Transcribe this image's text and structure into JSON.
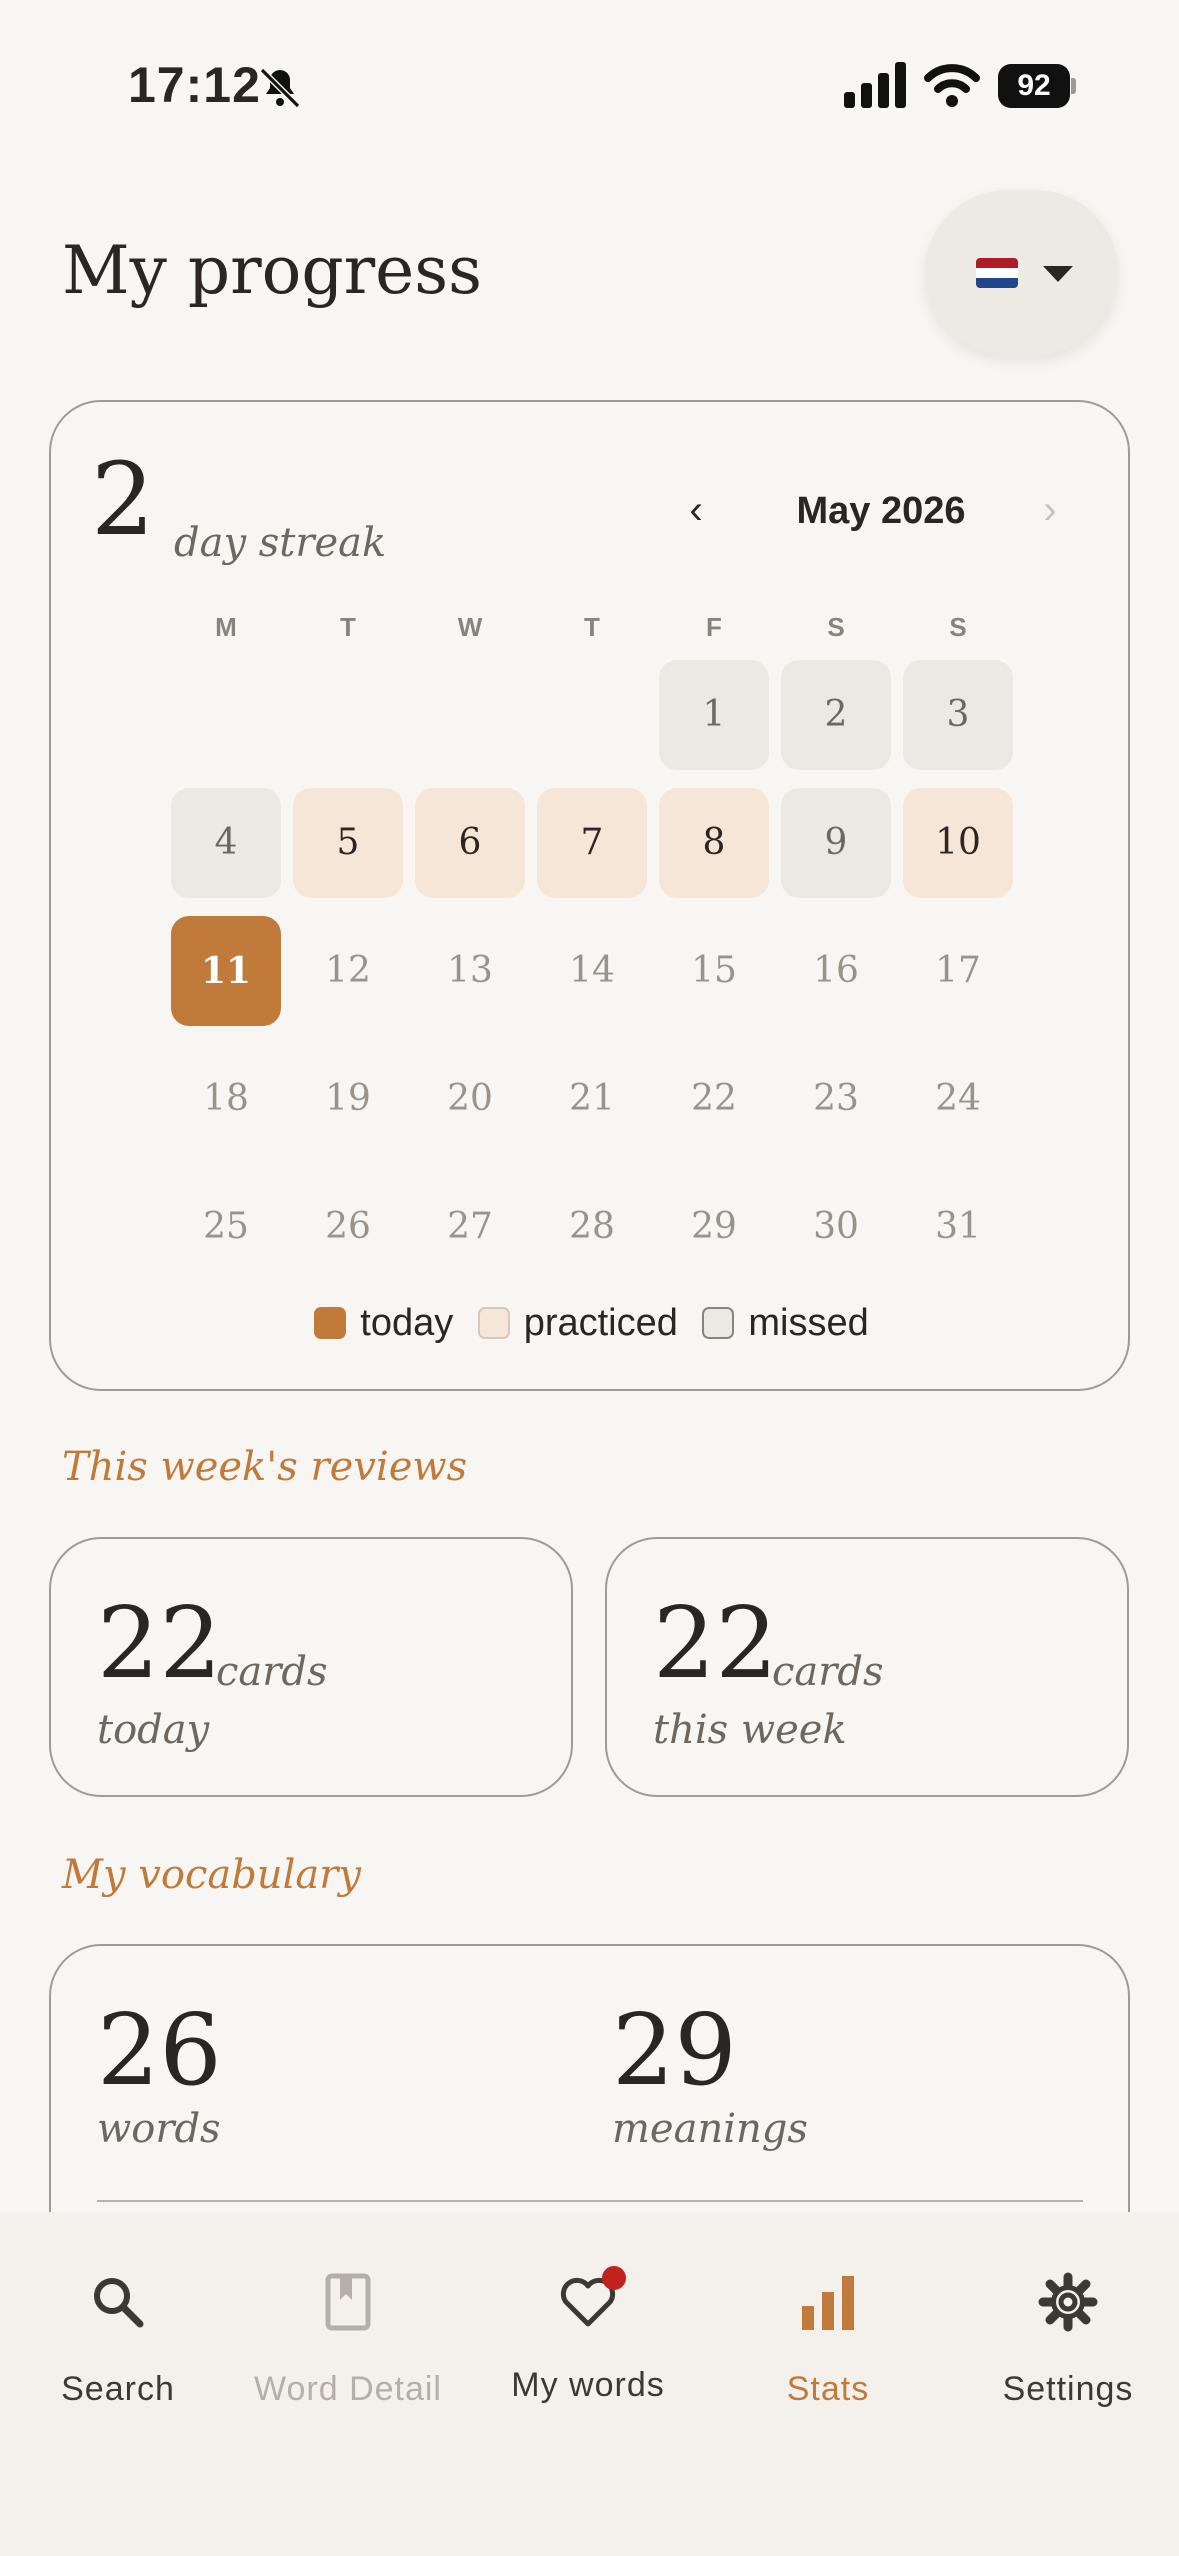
{
  "status_bar": {
    "time": "17:12",
    "battery": "92"
  },
  "header": {
    "title": "My progress"
  },
  "colors": {
    "accent": "#c07a3a",
    "practiced": "#f6e6d8",
    "missed": "#ece8e2",
    "background": "#f8f6f2"
  },
  "calendar": {
    "streak_count": "2",
    "streak_label": "day streak",
    "prev_icon": "‹",
    "month_label": "May 2026",
    "next_icon": "›",
    "weekdays": [
      "M",
      "T",
      "W",
      "T",
      "F",
      "S",
      "S"
    ],
    "days": [
      {
        "day": "1",
        "status": "missed"
      },
      {
        "day": "2",
        "status": "missed"
      },
      {
        "day": "3",
        "status": "missed"
      },
      {
        "day": "4",
        "status": "missed"
      },
      {
        "day": "5",
        "status": "practiced"
      },
      {
        "day": "6",
        "status": "practiced"
      },
      {
        "day": "7",
        "status": "practiced"
      },
      {
        "day": "8",
        "status": "practiced"
      },
      {
        "day": "9",
        "status": "missed"
      },
      {
        "day": "10",
        "status": "practiced"
      },
      {
        "day": "11",
        "status": "today"
      },
      {
        "day": "12",
        "status": "future"
      },
      {
        "day": "13",
        "status": "future"
      },
      {
        "day": "14",
        "status": "future"
      },
      {
        "day": "15",
        "status": "future"
      },
      {
        "day": "16",
        "status": "future"
      },
      {
        "day": "17",
        "status": "future"
      },
      {
        "day": "18",
        "status": "future"
      },
      {
        "day": "19",
        "status": "future"
      },
      {
        "day": "20",
        "status": "future"
      },
      {
        "day": "21",
        "status": "future"
      },
      {
        "day": "22",
        "status": "future"
      },
      {
        "day": "23",
        "status": "future"
      },
      {
        "day": "24",
        "status": "future"
      },
      {
        "day": "25",
        "status": "future"
      },
      {
        "day": "26",
        "status": "future"
      },
      {
        "day": "27",
        "status": "future"
      },
      {
        "day": "28",
        "status": "future"
      },
      {
        "day": "29",
        "status": "future"
      },
      {
        "day": "30",
        "status": "future"
      },
      {
        "day": "31",
        "status": "future"
      }
    ],
    "legend": {
      "today": "today",
      "practiced": "practiced",
      "missed": "missed"
    }
  },
  "reviews": {
    "section_title": "This week's reviews",
    "today": {
      "count": "22",
      "unit": "cards",
      "label": "today"
    },
    "week": {
      "count": "22",
      "unit": "cards",
      "label": "this week"
    }
  },
  "vocabulary": {
    "section_title": "My vocabulary",
    "words": {
      "count": "26",
      "label": "words"
    },
    "meanings": {
      "count": "29",
      "label": "meanings"
    }
  },
  "tabs": [
    {
      "label": "Search",
      "icon": "search-icon",
      "state": "normal"
    },
    {
      "label": "Word Detail",
      "icon": "bookmark-icon",
      "state": "disabled"
    },
    {
      "label": "My words",
      "icon": "heart-icon",
      "state": "normal"
    },
    {
      "label": "Stats",
      "icon": "bar-chart-icon",
      "state": "active"
    },
    {
      "label": "Settings",
      "icon": "gear-icon",
      "state": "normal"
    }
  ]
}
